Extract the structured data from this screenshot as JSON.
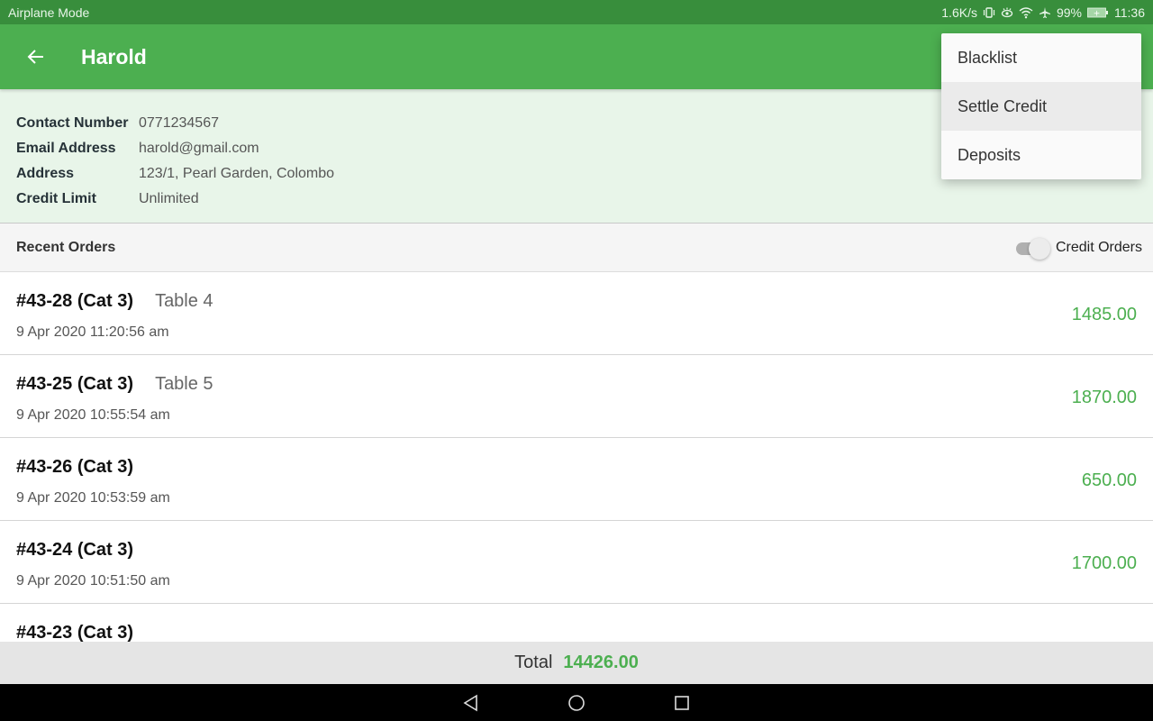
{
  "status_bar": {
    "left_text": "Airplane Mode",
    "net_speed": "1.6K/s",
    "battery": "99%",
    "time": "11:36",
    "icons": [
      "vibrate-icon",
      "eye-comfort-icon",
      "wifi-icon",
      "airplane-icon",
      "battery-icon"
    ]
  },
  "app_bar": {
    "back_icon": "arrow-left-icon",
    "title": "Harold"
  },
  "customer": {
    "fields": [
      {
        "label": "Contact Number",
        "value": "0771234567"
      },
      {
        "label": "Email Address",
        "value": "harold@gmail.com"
      },
      {
        "label": "Address",
        "value": "123/1, Pearl Garden, Colombo"
      },
      {
        "label": "Credit Limit",
        "value": "Unlimited"
      }
    ]
  },
  "orders_section": {
    "title": "Recent Orders",
    "toggle_label": "Credit Orders",
    "toggle_on": false
  },
  "orders": [
    {
      "id": "#43-28 (Cat 3)",
      "table": "Table 4",
      "date": "9 Apr 2020 11:20:56 am",
      "amount": "1485.00"
    },
    {
      "id": "#43-25 (Cat 3)",
      "table": "Table 5",
      "date": "9 Apr 2020 10:55:54 am",
      "amount": "1870.00"
    },
    {
      "id": "#43-26 (Cat 3)",
      "table": "",
      "date": "9 Apr 2020 10:53:59 am",
      "amount": "650.00"
    },
    {
      "id": "#43-24 (Cat 3)",
      "table": "",
      "date": "9 Apr 2020 10:51:50 am",
      "amount": "1700.00"
    },
    {
      "id": "#43-23 (Cat 3)",
      "table": "",
      "date": "",
      "amount": ""
    }
  ],
  "total": {
    "label": "Total",
    "value": "14426.00"
  },
  "menu": {
    "items": [
      {
        "label": "Blacklist",
        "highlighted": false
      },
      {
        "label": "Settle Credit",
        "highlighted": true
      },
      {
        "label": "Deposits",
        "highlighted": false
      }
    ]
  },
  "nav_bar": {
    "buttons": [
      "back-triangle-icon",
      "home-circle-icon",
      "recents-square-icon"
    ]
  },
  "colors": {
    "primary": "#4caf50",
    "primary_dark": "#388e3c",
    "info_bg": "#e8f5e9",
    "amount": "#4caf50"
  }
}
